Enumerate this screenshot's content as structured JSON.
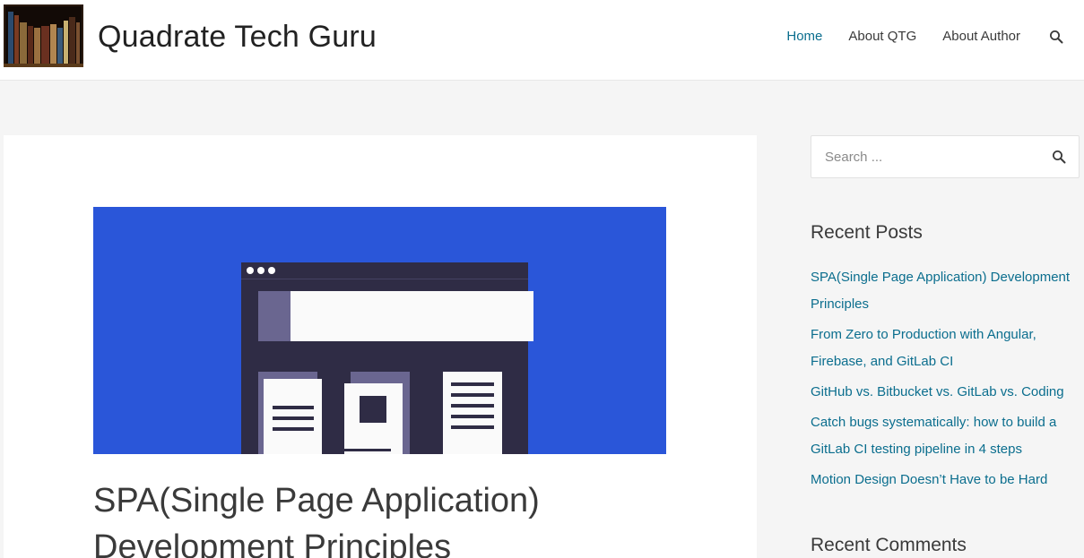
{
  "site": {
    "title": "Quadrate Tech Guru"
  },
  "nav": {
    "items": [
      {
        "label": "Home",
        "active": true
      },
      {
        "label": "About QTG",
        "active": false
      },
      {
        "label": "About Author",
        "active": false
      }
    ]
  },
  "article": {
    "title": "SPA(Single Page Application) Development Principles"
  },
  "sidebar": {
    "search_placeholder": "Search ...",
    "recent_posts_heading": "Recent Posts",
    "recent_posts": [
      "SPA(Single Page Application) Development Principles",
      "From Zero to Production with Angular, Firebase, and GitLab CI",
      "GitHub vs. Bitbucket vs. GitLab vs. Coding",
      "Catch bugs systematically: how to build a GitLab CI testing pipeline in 4 steps",
      "Motion Design Doesn’t Have to be Hard"
    ],
    "recent_comments_heading": "Recent Comments"
  },
  "colors": {
    "link": "#0b6e8e",
    "hero_blue": "#2a56d9",
    "hero_dark": "#2f2c45"
  },
  "icons": {
    "nav_search": "search-icon",
    "sidebar_search": "search-icon",
    "logo": "bookshelf-logo"
  }
}
